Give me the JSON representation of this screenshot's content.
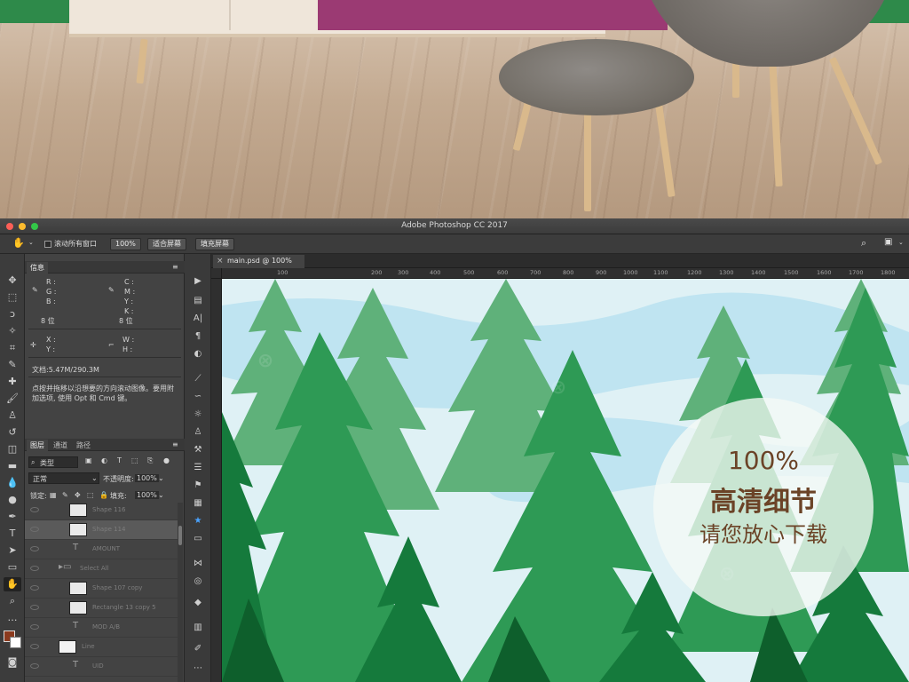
{
  "window": {
    "app_title": "Adobe Photoshop CC 2017",
    "traffic_colors": [
      "#fc5f57",
      "#fdbc2e",
      "#33c748"
    ]
  },
  "options_bar": {
    "scroll_all_windows_label": "滚动所有窗口",
    "zoom_label": "100%",
    "fit_screen_label": "适合屏幕",
    "fill_screen_label": "填充屏幕"
  },
  "info_panel": {
    "tab_label": "信息",
    "rgb_labels": [
      "R :",
      "G :",
      "B :"
    ],
    "cmyk_labels": [
      "C :",
      "M :",
      "Y :",
      "K :"
    ],
    "bit_depth_left": "8 位",
    "bit_depth_right": "8 位",
    "xy_labels": [
      "X :",
      "Y :"
    ],
    "wh_labels": [
      "W :",
      "H :"
    ],
    "doc_size": "文档:5.47M/290.3M",
    "hint_line1": "点按并拖移以沿想要的方向滚动图像。要用附",
    "hint_line2": "加选项, 使用 Opt 和 Cmd 键。"
  },
  "layers_panel": {
    "tabs": [
      "图层",
      "通道",
      "路径"
    ],
    "filter_kind": "类型",
    "blend_mode": "正常",
    "opacity_label": "不透明度:",
    "opacity_value": "100%",
    "lock_label": "锁定:",
    "fill_label": "填充:",
    "fill_value": "100%",
    "layers": [
      {
        "name": "Shape 116",
        "kind": "shape"
      },
      {
        "name": "Shape 114",
        "kind": "shape"
      },
      {
        "name": "AMOUNT",
        "kind": "text"
      },
      {
        "name": "Select All",
        "kind": "group"
      },
      {
        "name": "Shape 107 copy",
        "kind": "shape"
      },
      {
        "name": "Rectangle 13 copy 5",
        "kind": "shape"
      },
      {
        "name": "MOD A/B",
        "kind": "text"
      },
      {
        "name": "Line",
        "kind": "shape"
      },
      {
        "name": "UID",
        "kind": "text"
      }
    ]
  },
  "document": {
    "tab_label": "main.psd @ 100%",
    "ruler_ticks": [
      "100",
      "200",
      "300",
      "400",
      "500",
      "600",
      "700",
      "800",
      "900",
      "1000",
      "1100",
      "1200",
      "1300",
      "1400",
      "1500",
      "1600",
      "1700",
      "1800"
    ],
    "overlay_percent": "100%",
    "overlay_line1": "高清细节",
    "overlay_line2": "请您放心下载"
  },
  "colors": {
    "forest_dark": "#157a3c",
    "forest_mid": "#2e9a55",
    "forest_light": "#5fb17a",
    "sky": "#bfe4f1",
    "foreground_swatch": "#8b3a1e",
    "overlay_text": "#6b4327"
  }
}
